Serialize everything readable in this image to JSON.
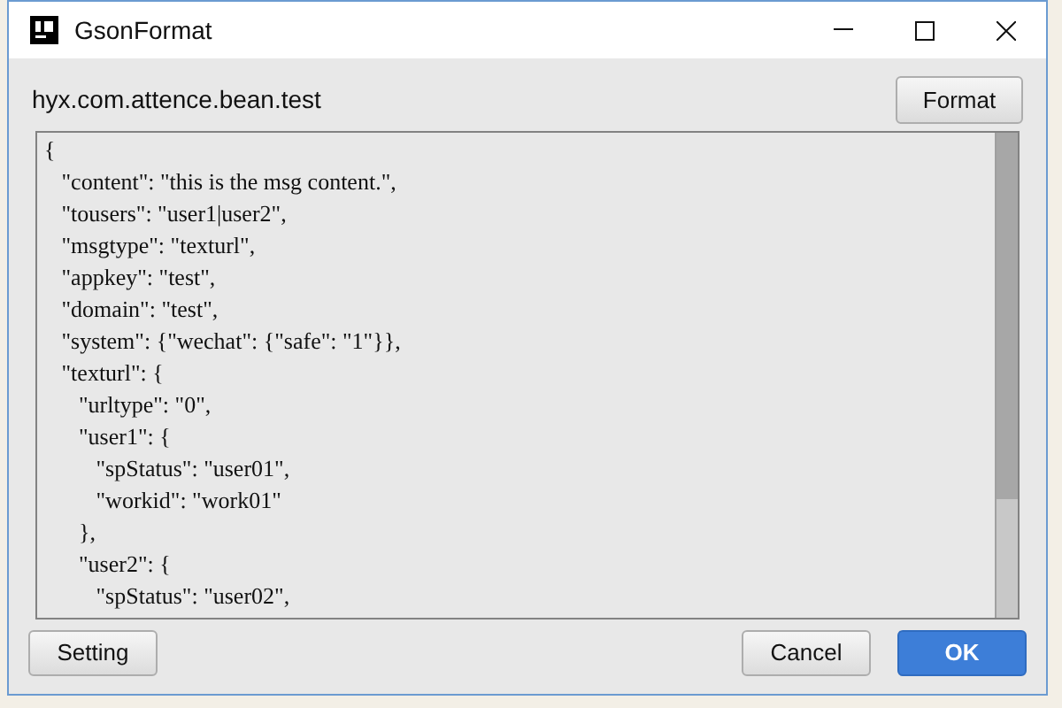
{
  "window": {
    "title": "GsonFormat"
  },
  "class_name": "hyx.com.attence.bean.test",
  "format_button": "Format",
  "code_lines": [
    "{",
    "   \"content\": \"this is the msg content.\",",
    "   \"tousers\": \"user1|user2\",",
    "   \"msgtype\": \"texturl\",",
    "   \"appkey\": \"test\",",
    "   \"domain\": \"test\",",
    "   \"system\": {\"wechat\": {\"safe\": \"1\"}},",
    "   \"texturl\": {",
    "      \"urltype\": \"0\",",
    "      \"user1\": {",
    "         \"spStatus\": \"user01\",",
    "         \"workid\": \"work01\"",
    "      },",
    "      \"user2\": {",
    "         \"spStatus\": \"user02\","
  ],
  "buttons": [
    {
      "label": "Setting",
      "kind": "normal"
    },
    {
      "label": "Cancel",
      "kind": "normal"
    },
    {
      "label": "OK",
      "kind": "primary"
    }
  ]
}
